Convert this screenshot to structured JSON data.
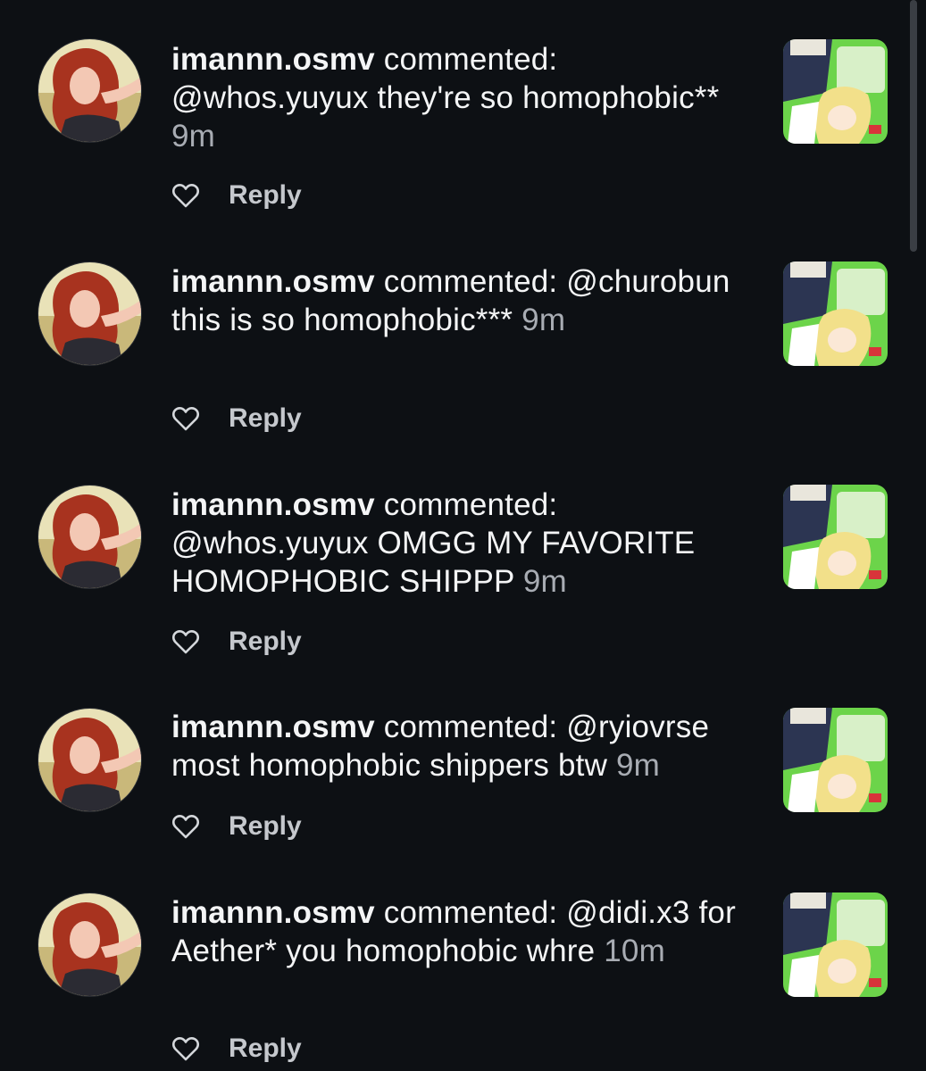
{
  "comments": [
    {
      "username": "imannn.osmv",
      "verb": "commented:",
      "body": "@whos.yuyux they're so homophobic**",
      "time": "9m",
      "reply_label": "Reply",
      "like_icon": "heart-outline-icon"
    },
    {
      "username": "imannn.osmv",
      "verb": "commented:",
      "body": "@churobun this is so homophobic***",
      "time": "9m",
      "reply_label": "Reply",
      "like_icon": "heart-outline-icon"
    },
    {
      "username": "imannn.osmv",
      "verb": "commented:",
      "body": "@whos.yuyux OMGG MY FAVORITE HOMOPHOBIC SHIPPP",
      "time": "9m",
      "reply_label": "Reply",
      "like_icon": "heart-outline-icon"
    },
    {
      "username": "imannn.osmv",
      "verb": "commented:",
      "body": "@ryiovrse most homophobic shippers btw",
      "time": "9m",
      "reply_label": "Reply",
      "like_icon": "heart-outline-icon"
    },
    {
      "username": "imannn.osmv",
      "verb": "commented:",
      "body": "@didi.x3 for Aether* you homophobic whre",
      "time": "10m",
      "reply_label": "Reply",
      "like_icon": "heart-outline-icon"
    }
  ],
  "colors": {
    "background": "#0d1014",
    "text": "#f4f5f6",
    "timestamp": "#a8acb3",
    "reply": "#c5c8cd",
    "thumb_green": "#6cd44a"
  }
}
